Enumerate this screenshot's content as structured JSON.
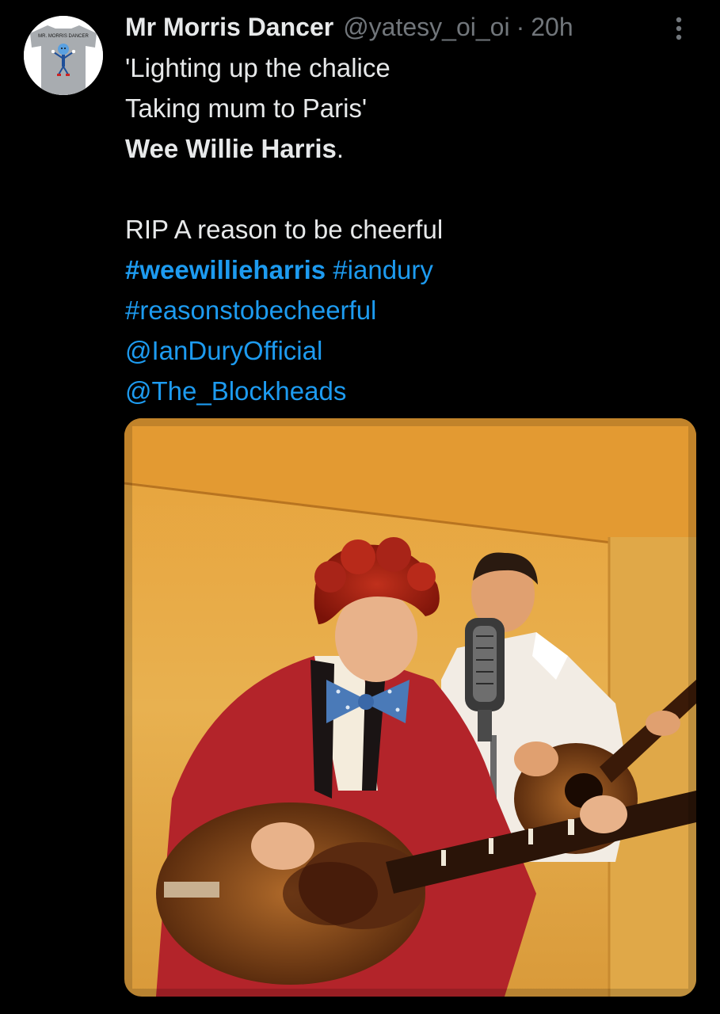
{
  "author": {
    "display_name": "Mr Morris Dancer",
    "handle": "@yatesy_oi_oi",
    "separator": "·",
    "time": "20h",
    "avatar_caption": "MR. MORRIS DANCER"
  },
  "menu": {
    "icon": "more-vertical-icon"
  },
  "tweet": {
    "line1": "'Lighting up the chalice",
    "line2": "Taking mum to Paris'",
    "line3_bold": "Wee Willie Harris",
    "line3_tail": ".",
    "line4": "RIP A reason to be cheerful",
    "hashtag1": "#weewillieharris",
    "hashtag2": "#iandury",
    "hashtag3": "#reasonstobecheerful",
    "mention1": "@IanDuryOfficial",
    "mention2": "@The_Blockheads"
  },
  "media": {
    "type": "photo",
    "subject": "vintage-color-photo-two-guitarists-with-microphone"
  },
  "colors": {
    "background": "#000000",
    "text": "#e7e9ea",
    "secondary": "#71767b",
    "link": "#1d9bf0"
  }
}
